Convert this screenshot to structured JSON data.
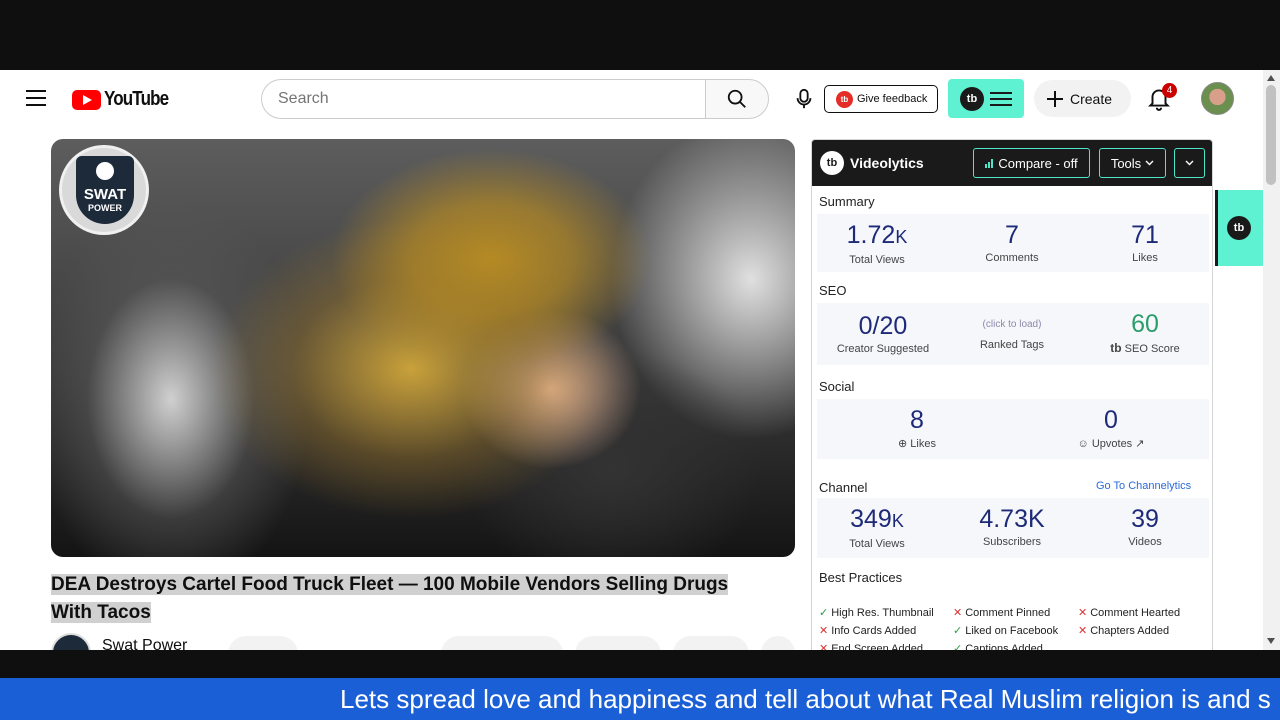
{
  "masthead": {
    "logo_text": "YouTube",
    "search_placeholder": "Search",
    "feedback_label": "Give feedback",
    "tb_badge": "tb",
    "create_label": "Create",
    "notification_count": "4"
  },
  "video": {
    "channel_logo_word": "SWAT",
    "channel_logo_sub": "POWER",
    "title": "DEA Destroys Cartel Food Truck Fleet — 100 Mobile Vendors Selling Drugs With Tacos",
    "channel_name": "Swat Power"
  },
  "videolytics": {
    "name": "Videolytics",
    "compare_label": "Compare - off",
    "tools_label": "Tools",
    "summary": {
      "title": "Summary",
      "views": "1.72",
      "views_unit": "K",
      "views_label": "Total Views",
      "comments": "7",
      "comments_label": "Comments",
      "likes": "71",
      "likes_label": "Likes"
    },
    "seo": {
      "title": "SEO",
      "creator_suggested": "0/20",
      "creator_suggested_label": "Creator Suggested",
      "click_to_load": "(click to load)",
      "ranked_tags_label": "Ranked Tags",
      "seo_score": "60",
      "seo_score_label": "SEO Score"
    },
    "social": {
      "title": "Social",
      "likes": "8",
      "likes_label": "Likes",
      "upvotes": "0",
      "upvotes_label": "Upvotes"
    },
    "channel": {
      "title": "Channel",
      "link": "Go To Channelytics",
      "views": "349",
      "views_unit": "K",
      "views_label": "Total Views",
      "subscribers": "4.73K",
      "subscribers_label": "Subscribers",
      "videos": "39",
      "videos_label": "Videos"
    },
    "best_practices": {
      "title": "Best Practices",
      "items": [
        {
          "label": "High Res. Thumbnail",
          "ok": true
        },
        {
          "label": "Comment Pinned",
          "ok": false
        },
        {
          "label": "Comment Hearted",
          "ok": false
        },
        {
          "label": "Info Cards Added",
          "ok": false
        },
        {
          "label": "Liked on Facebook",
          "ok": true
        },
        {
          "label": "Chapters Added",
          "ok": false
        },
        {
          "label": "End Screen Added",
          "ok": false
        },
        {
          "label": "Captions Added",
          "ok": true
        }
      ]
    }
  },
  "ticker": {
    "text": "Lets spread love and happiness and tell about what Real Muslim religion is and s"
  },
  "colors": {
    "accent_teal": "#5ff2d2",
    "youtube_red": "#ff0000",
    "ticker_blue": "#1a5fd6",
    "stat_navy": "#1e2a78",
    "seo_green": "#2a9d6a"
  }
}
